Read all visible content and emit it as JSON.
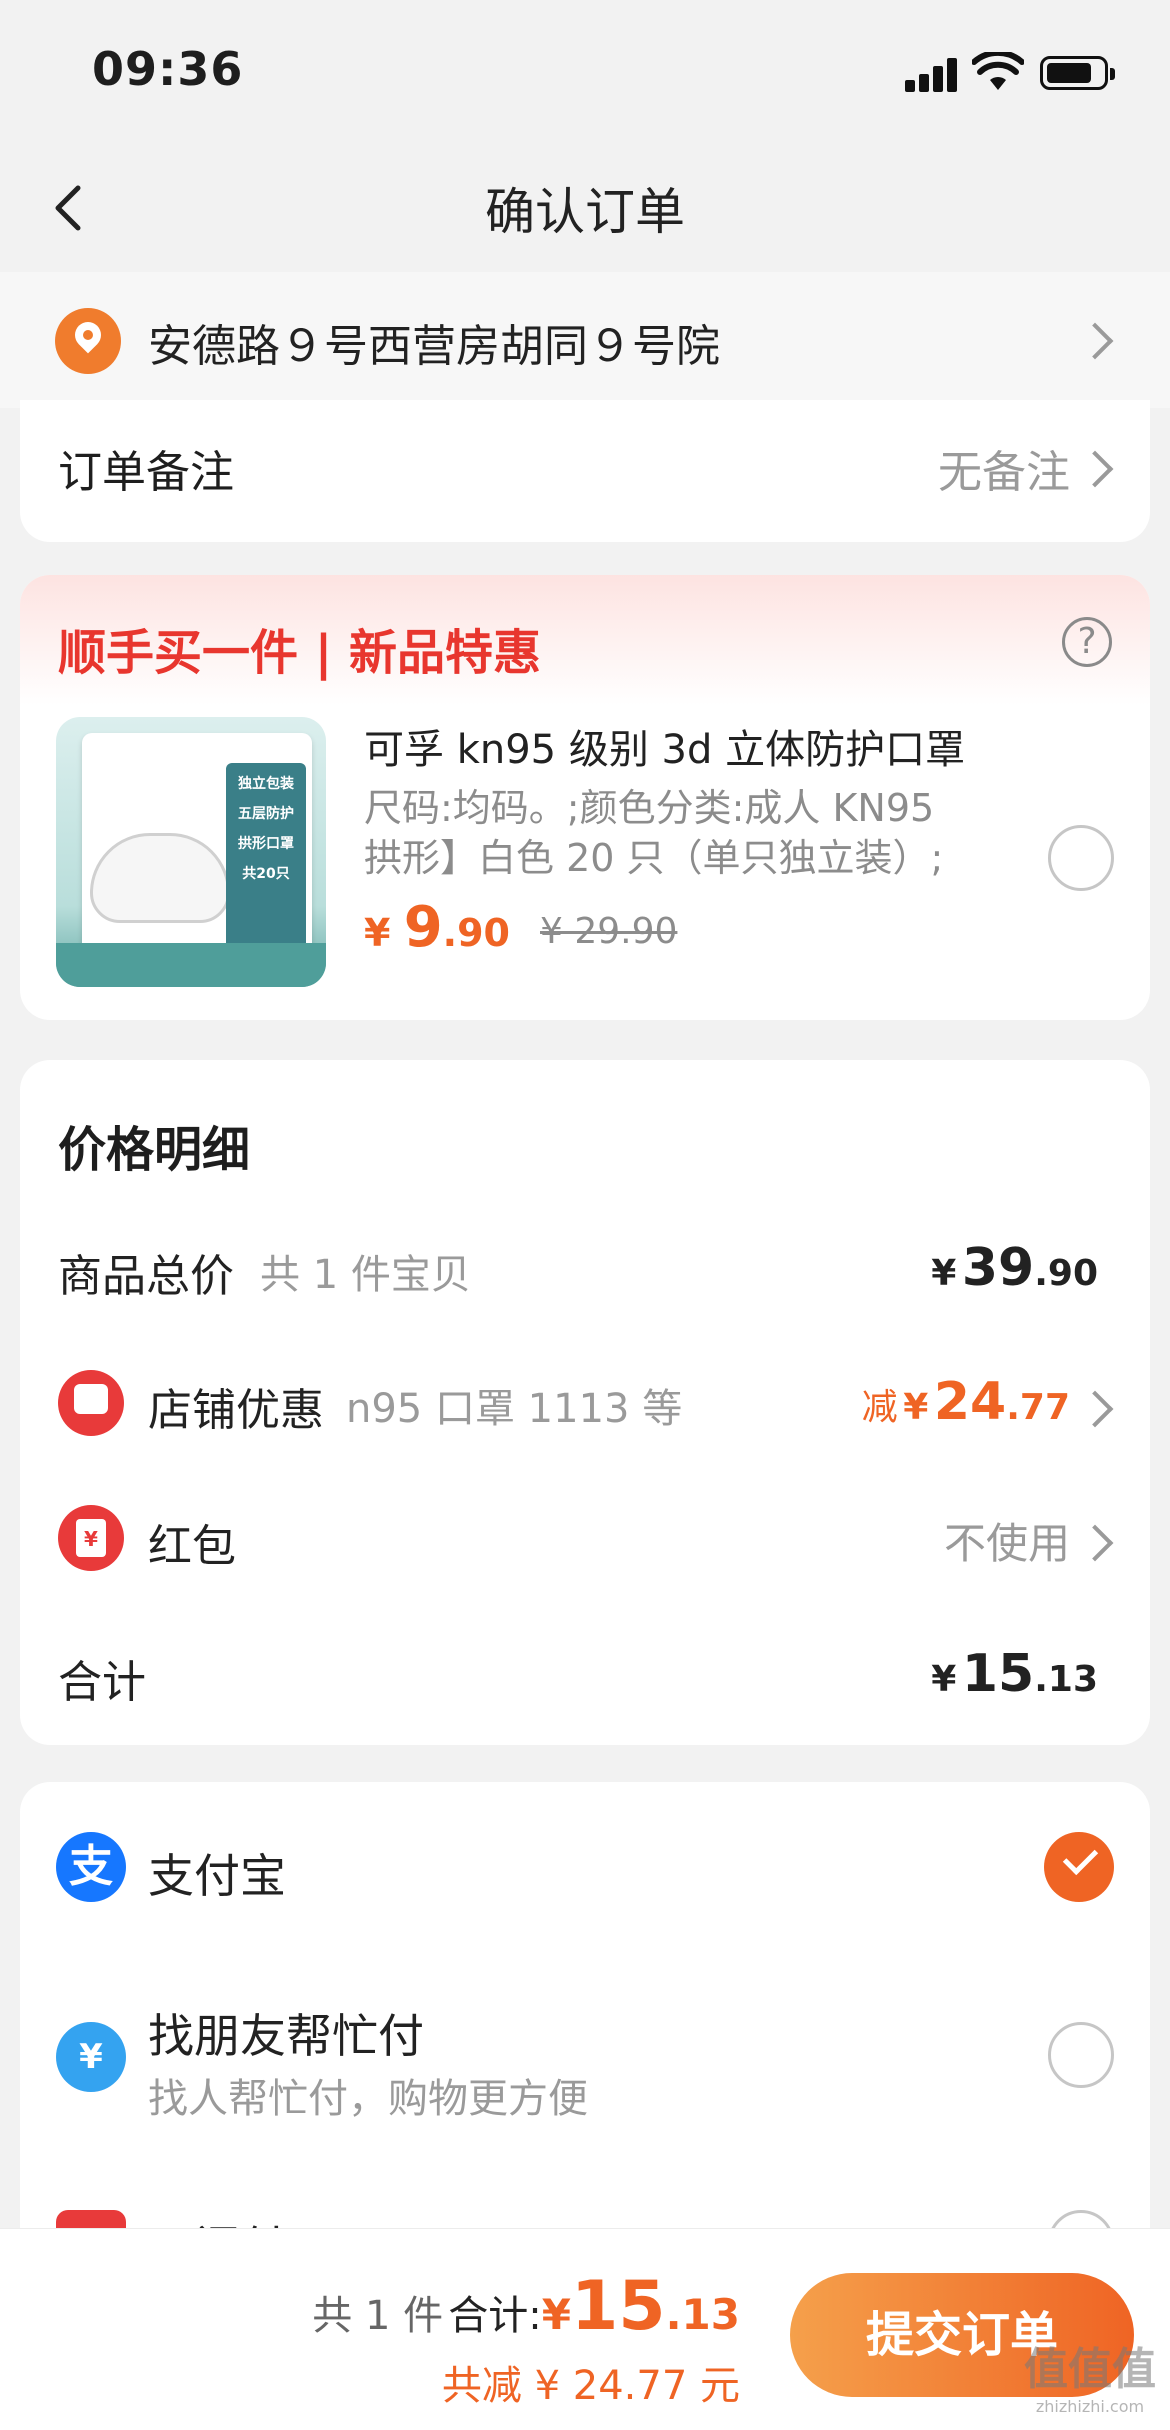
{
  "status_bar": {
    "time": "09:36"
  },
  "header": {
    "title": "确认订单"
  },
  "address": {
    "text": "安德路９号西营房胡同９号院"
  },
  "remark": {
    "label": "订单备注",
    "value": "无备注"
  },
  "promo": {
    "title": "顺手买一件 | 新品特惠",
    "product": {
      "name": "可孚 kn95 级别 3d 立体防护口罩",
      "spec_line1": "尺码:均码。;颜色分类:成人 KN95",
      "spec_line2": "拱形】白色 20 只（单只独立装）;",
      "currency": "¥",
      "price_int": "9",
      "price_dec": ".90",
      "original_price": "¥ 29.90",
      "thumb_text_1": "独立包装",
      "thumb_text_2": "五层防护",
      "thumb_text_3": "拱形口罩",
      "thumb_text_4": "共20只"
    }
  },
  "price_detail": {
    "title": "价格明细",
    "goods": {
      "label": "商品总价",
      "sub": "共 1 件宝贝",
      "currency": "¥",
      "int": "39",
      "dec": ".90"
    },
    "store_discount": {
      "label": "店铺优惠",
      "sub": "n95 口罩 1113 等",
      "prefix": "减",
      "currency": "¥",
      "int": "24",
      "dec": ".77"
    },
    "red_packet": {
      "label": "红包",
      "value": "不使用",
      "icon_text": "¥"
    },
    "total": {
      "label": "合计",
      "currency": "¥",
      "int": "15",
      "dec": ".13"
    }
  },
  "payment": {
    "alipay": {
      "label": "支付宝",
      "icon_text": "支"
    },
    "friend": {
      "label": "找朋友帮忙付",
      "sub": "找人帮忙付，购物更方便",
      "icon_text": "¥"
    },
    "third_partial": "云闪付"
  },
  "bottom_bar": {
    "count": "共 1 件",
    "total_label": "合计:",
    "currency": "¥",
    "total_int": "15",
    "total_dec": ".13",
    "saved": "共减 ¥ 24.77 元",
    "submit": "提交订单"
  },
  "watermark": {
    "title": "值值值",
    "url": "zhizhizhi.com"
  },
  "colors": {
    "accent": "#ef6424",
    "red": "#e83a3a",
    "alipay": "#1677ff"
  },
  "selected_payment": "alipay"
}
